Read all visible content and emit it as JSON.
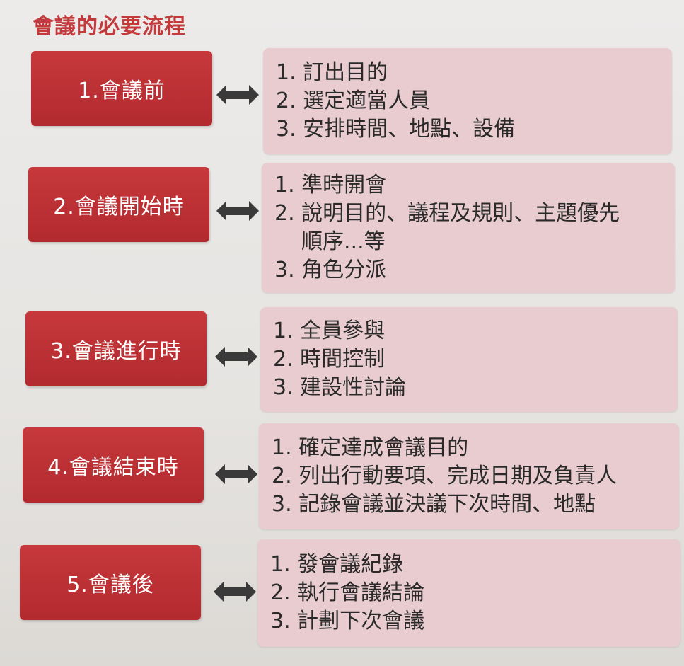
{
  "title": "會議的必要流程",
  "stages": [
    {
      "label": "1.會議前",
      "items": [
        "1. 訂出目的",
        "2. 選定適當人員",
        "3. 安排時間、地點、設備"
      ]
    },
    {
      "label": "2.會議開始時",
      "items": [
        "1. 準時開會",
        "2. 說明目的、議程及規則、主題優先",
        "順序...等",
        "3. 角色分派"
      ]
    },
    {
      "label": "3.會議進行時",
      "items": [
        "1. 全員參與",
        "2. 時間控制",
        "3. 建設性討論"
      ]
    },
    {
      "label": "4.會議結束時",
      "items": [
        "1. 確定達成會議目的",
        "2. 列出行動要項、完成日期及負責人",
        "3. 記錄會議並決議下次時間、地點"
      ]
    },
    {
      "label": "5.會議後",
      "items": [
        "1. 發會議紀錄",
        "2. 執行會議結論",
        "3. 計劃下次會議"
      ]
    }
  ],
  "colors": {
    "title": "#c23a3c",
    "stage_box": "#b8302f",
    "detail_box": "#e9ccd0",
    "arrow": "#3a3a3a"
  },
  "icons": {
    "connector": "double-arrow-icon"
  }
}
